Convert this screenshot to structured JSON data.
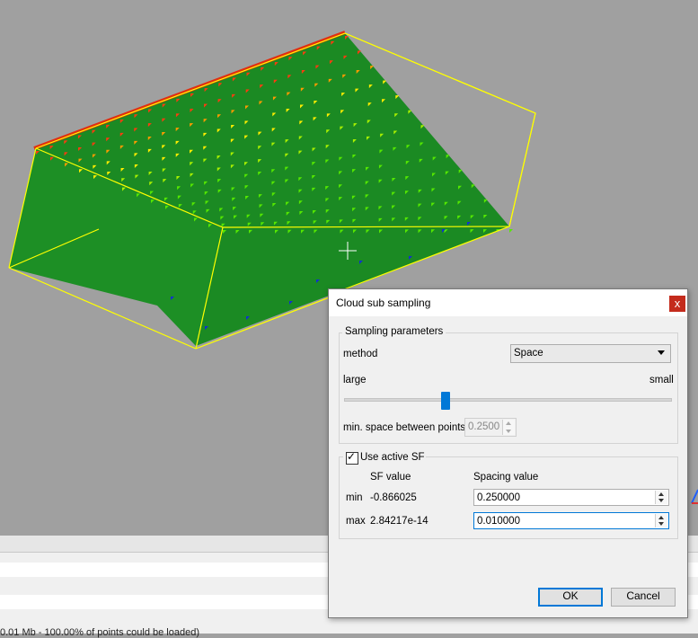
{
  "dialog": {
    "title": "Cloud sub sampling",
    "close_label": "x",
    "sampling_group": {
      "title": "Sampling parameters",
      "method_label": "method",
      "method_value": "Space",
      "slider_left_label": "large",
      "slider_right_label": "small",
      "slider_level_percent": 31,
      "min_space_label": "min. space between points",
      "min_space_value": "0.2500"
    },
    "sf_group": {
      "title": "Use active SF",
      "checked": true,
      "sf_value_header": "SF value",
      "spacing_value_header": "Spacing value",
      "rows": [
        {
          "label": "min",
          "sf_value": "-0.866025",
          "spacing": "0.250000"
        },
        {
          "label": "max",
          "sf_value": "2.84217e-14",
          "spacing": "0.010000"
        }
      ]
    },
    "ok_label": "OK",
    "cancel_label": "Cancel"
  },
  "status": {
    "text": "0.01 Mb - 100.00% of points could be loaded)"
  },
  "colors": {
    "viewport_bg": "#a0a0a0",
    "cloud_green": "#1b8a23",
    "bbox_yellow": "#ffff00",
    "accent_blue": "#0078d7",
    "close_red": "#c42b1c"
  }
}
